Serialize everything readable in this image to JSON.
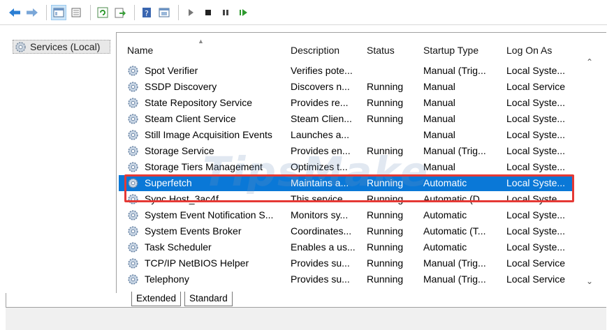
{
  "toolbar": {
    "buttons": [
      "back-arrow-icon",
      "forward-arrow-icon",
      "console-tree-icon",
      "properties-icon",
      "refresh-icon",
      "export-icon",
      "help-icon",
      "mmc-icon",
      "play-icon",
      "stop-icon",
      "pause-icon",
      "restart-icon"
    ]
  },
  "tree": {
    "root_label": "Services (Local)"
  },
  "columns": {
    "name": "Name",
    "description": "Description",
    "status": "Status",
    "startup_type": "Startup Type",
    "log_on_as": "Log On As"
  },
  "services": [
    {
      "name": "Spot Verifier",
      "description": "Verifies pote...",
      "status": "",
      "startup": "Manual (Trig...",
      "logon": "Local Syste..."
    },
    {
      "name": "SSDP Discovery",
      "description": "Discovers n...",
      "status": "Running",
      "startup": "Manual",
      "logon": "Local Service"
    },
    {
      "name": "State Repository Service",
      "description": "Provides re...",
      "status": "Running",
      "startup": "Manual",
      "logon": "Local Syste..."
    },
    {
      "name": "Steam Client Service",
      "description": "Steam Clien...",
      "status": "Running",
      "startup": "Manual",
      "logon": "Local Syste..."
    },
    {
      "name": "Still Image Acquisition Events",
      "description": "Launches a...",
      "status": "",
      "startup": "Manual",
      "logon": "Local Syste..."
    },
    {
      "name": "Storage Service",
      "description": "Provides en...",
      "status": "Running",
      "startup": "Manual (Trig...",
      "logon": "Local Syste..."
    },
    {
      "name": "Storage Tiers Management",
      "description": "Optimizes t...",
      "status": "",
      "startup": "Manual",
      "logon": "Local Syste..."
    },
    {
      "name": "Superfetch",
      "description": "Maintains a...",
      "status": "Running",
      "startup": "Automatic",
      "logon": "Local Syste..."
    },
    {
      "name": "Sync Host_3ac4f",
      "description": "This service ...",
      "status": "Running",
      "startup": "Automatic (D...",
      "logon": "Local Syste..."
    },
    {
      "name": "System Event Notification S...",
      "description": "Monitors sy...",
      "status": "Running",
      "startup": "Automatic",
      "logon": "Local Syste..."
    },
    {
      "name": "System Events Broker",
      "description": "Coordinates...",
      "status": "Running",
      "startup": "Automatic (T...",
      "logon": "Local Syste..."
    },
    {
      "name": "Task Scheduler",
      "description": "Enables a us...",
      "status": "Running",
      "startup": "Automatic",
      "logon": "Local Syste..."
    },
    {
      "name": "TCP/IP NetBIOS Helper",
      "description": "Provides su...",
      "status": "Running",
      "startup": "Manual (Trig...",
      "logon": "Local Service"
    },
    {
      "name": "Telephony",
      "description": "Provides su...",
      "status": "Running",
      "startup": "Manual (Trig...",
      "logon": "Local Service"
    }
  ],
  "selected_service": "Superfetch",
  "tabs": {
    "extended": "Extended",
    "standard": "Standard"
  },
  "watermark": "TipsMake",
  "colors": {
    "selection": "#0a78d7",
    "highlight_box": "#e53935",
    "gear_blue": "#5b8fc7"
  }
}
